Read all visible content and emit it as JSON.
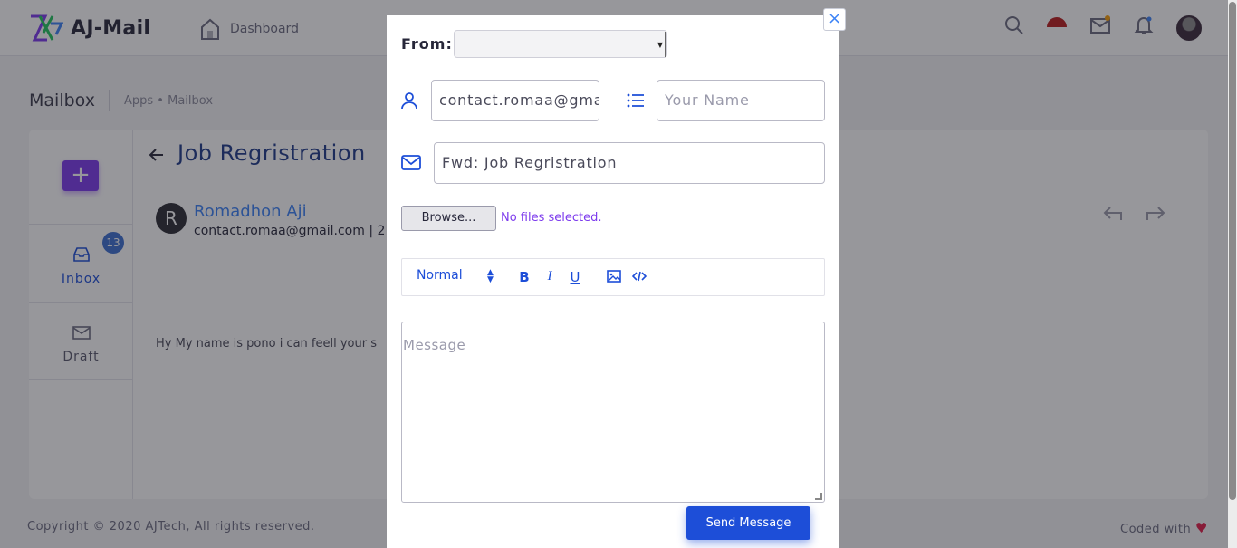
{
  "app": {
    "brand": "AJ-Mail",
    "nav_dashboard": "Dashboard"
  },
  "page": {
    "title": "Mailbox",
    "breadcrumb": "Apps • Mailbox"
  },
  "sidebar": {
    "compose_symbol": "+",
    "items": [
      {
        "label": "Inbox",
        "badge": "13",
        "icon": "inbox-icon"
      },
      {
        "label": "Draft",
        "icon": "mail-icon"
      }
    ]
  },
  "mail": {
    "subject": "Job Regristration",
    "sender_initial": "R",
    "sender_name": "Romadhon Aji",
    "sender_email": "contact.romaa@gmail.com | 2",
    "body": "Hy My name is pono i can feell your s"
  },
  "footer": {
    "copyright": "Copyright © 2020 AJTech, All rights reserved.",
    "coded_with": "Coded with",
    "heart": "♥"
  },
  "modal": {
    "close_symbol": "×",
    "from_label": "From:",
    "from_value": "",
    "to_value": "contact.romaa@gma",
    "name_placeholder": "Your Name",
    "subject_value": "Fwd: Job Regristration",
    "browse_label": "Browse...",
    "no_files": "No files selected.",
    "editor": {
      "format": "Normal",
      "bold": "B",
      "italic": "I",
      "underline": "U"
    },
    "message_placeholder": "Message",
    "send_label": "Send Message"
  },
  "colors": {
    "accent": "#1d4ed8",
    "compose": "#7c3aed",
    "badge": "#3b6fd1",
    "overlay": "rgba(28,28,38,0.46)"
  }
}
